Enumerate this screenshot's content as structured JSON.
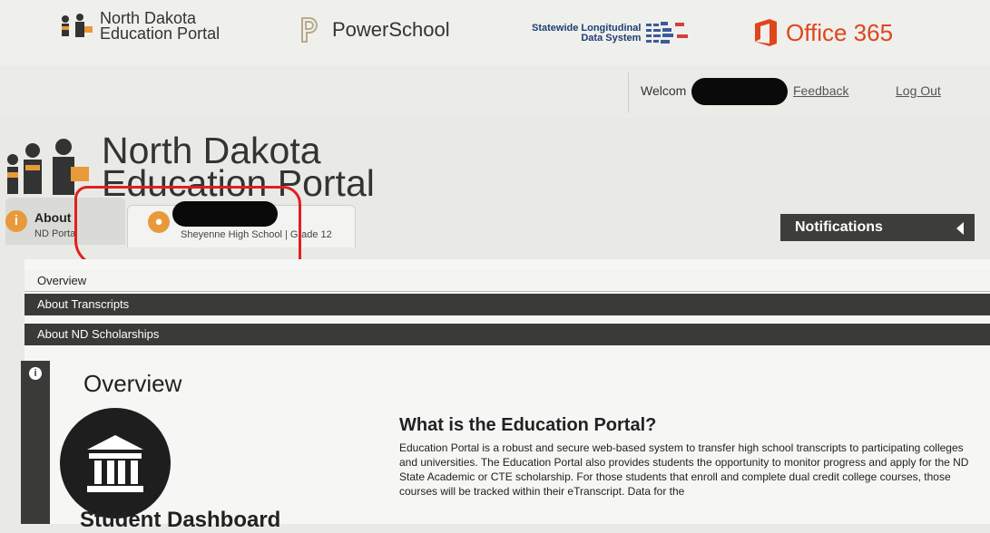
{
  "header": {
    "nd_portal_brand": "North Dakota\nEducation Portal",
    "powerschool_brand": "PowerSchool",
    "slds_brand_line1": "Statewide Longitudinal",
    "slds_brand_line2": "Data System",
    "office_brand": "Office 365"
  },
  "user_bar": {
    "welcome_label": "Welcom",
    "feedback_link": "Feedback",
    "logout_link": "Log Out"
  },
  "big_logo": {
    "line1": "North Dakota",
    "line2": "Education Portal"
  },
  "tabs": [
    {
      "title": "About",
      "subtitle": "ND Portal"
    },
    {
      "title": "",
      "subtitle": "Sheyenne High School | Grade 12"
    }
  ],
  "notifications": {
    "label": "Notifications"
  },
  "menu": [
    {
      "label": "Overview"
    },
    {
      "label": "About Transcripts"
    },
    {
      "label": "About ND Scholarships"
    }
  ],
  "content": {
    "section_title": "Overview",
    "dashboard_title": "Student Dashboard",
    "question_title": "What is the Education Portal?",
    "body": "Education Portal is a robust and secure web-based system to transfer high school transcripts to participating colleges and universities. The Education Portal also provides students the opportunity to monitor progress and apply for the ND State Academic or CTE scholarship. For those students that enroll and complete dual credit college courses, those courses will be tracked within their eTranscript. Data for the"
  },
  "colors": {
    "accent_orange": "#e89a3a",
    "office_red": "#e0451c",
    "dark_bar": "#3a3a38",
    "annotation_red": "#e02020"
  },
  "icons": [
    "nd-portal-logo-icon",
    "powerschool-logo-icon",
    "slds-logo-icon",
    "office-logo-icon",
    "info-icon",
    "person-icon",
    "chevron-left-icon",
    "institution-icon"
  ]
}
